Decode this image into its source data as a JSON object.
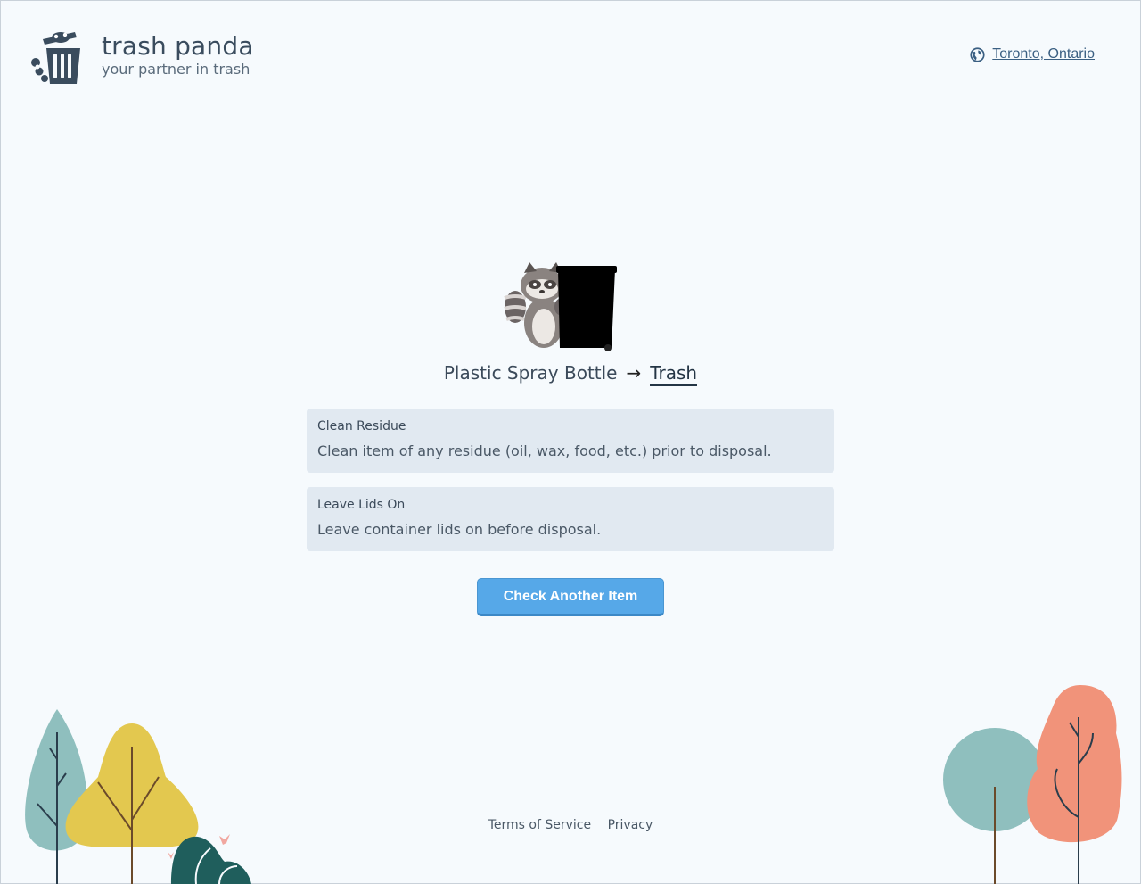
{
  "header": {
    "brand_name": "trash panda",
    "brand_tagline": "your partner in trash",
    "location": "Toronto, Ontario"
  },
  "result": {
    "item": "Plastic Spray Bottle",
    "arrow": "→",
    "destination": "Trash"
  },
  "instructions": [
    {
      "title": "Clean Residue",
      "description": "Clean item of any residue (oil, wax, food, etc.) prior to disposal."
    },
    {
      "title": "Leave Lids On",
      "description": "Leave container lids on before disposal."
    }
  ],
  "actions": {
    "check_another": "Check Another Item"
  },
  "footer": {
    "terms": "Terms of Service",
    "privacy": "Privacy"
  },
  "colors": {
    "background": "#f6fafd",
    "card": "#e1e9f1",
    "button": "#56a8e8",
    "brand_dark": "#3a4c5e",
    "tree_teal": "#8fbfbe",
    "tree_yellow": "#e3c84f",
    "tree_coral": "#f1937a",
    "tree_dark_green": "#1f5e5c"
  },
  "icons": [
    "raccoon-trash-logo-icon",
    "globe-icon",
    "raccoon-bin-illustration",
    "arrow-right-icon"
  ]
}
